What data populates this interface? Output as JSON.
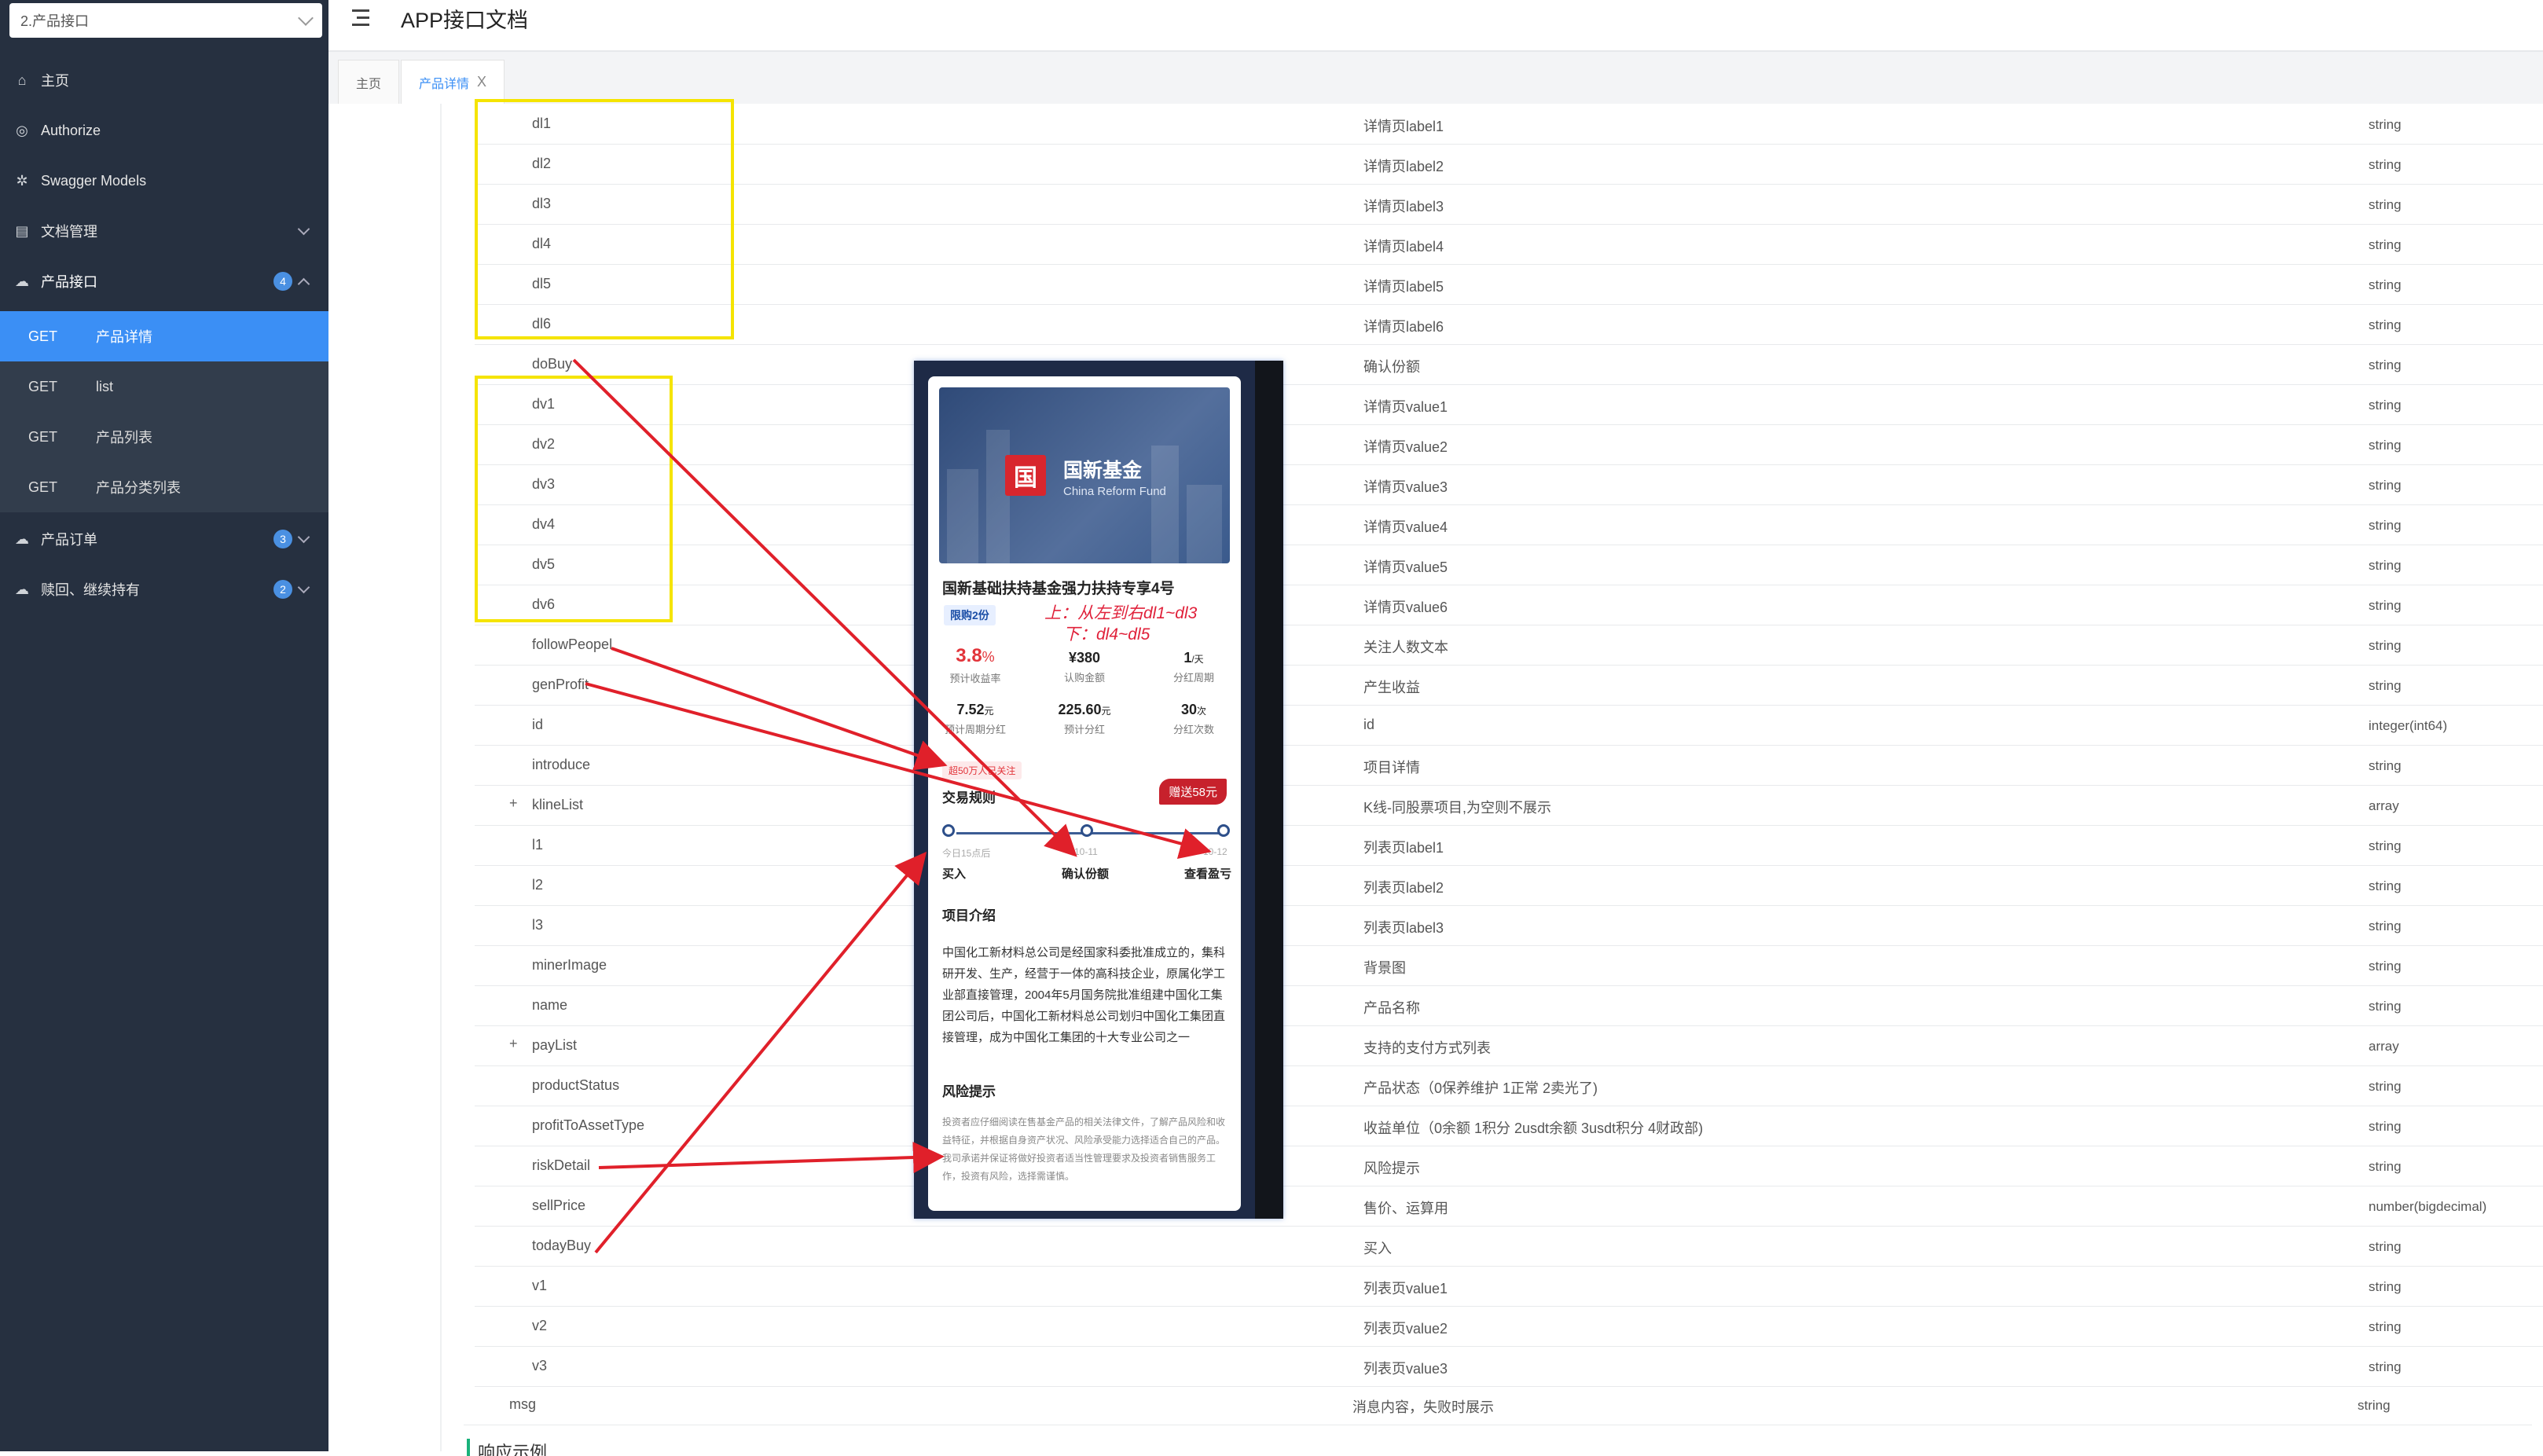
{
  "sidebar": {
    "group_select": "2.产品接口",
    "menu": [
      {
        "label": "主页"
      },
      {
        "label": "Authorize"
      },
      {
        "label": "Swagger Models"
      },
      {
        "label": "文档管理"
      },
      {
        "label": "产品接口",
        "badge": "4"
      }
    ],
    "sub_items": [
      {
        "method": "GET",
        "name": "产品详情"
      },
      {
        "method": "GET",
        "name": "list"
      },
      {
        "method": "GET",
        "name": "产品列表"
      },
      {
        "method": "GET",
        "name": "产品分类列表"
      }
    ],
    "menu_after": [
      {
        "label": "产品订单",
        "badge": "3"
      },
      {
        "label": "赎回、继续持有",
        "badge": "2"
      }
    ],
    "colors": {
      "bg": "#263040",
      "active": "#3b8ff5",
      "badge": "#4a90e2"
    }
  },
  "header": {
    "title": "APP接口文档",
    "menu_icon": "hamburger-icon"
  },
  "tabs": [
    {
      "label": "主页"
    },
    {
      "label": "产品详情",
      "close": "X"
    }
  ],
  "fields": [
    {
      "name": "dl1",
      "desc": "详情页label1",
      "type": "string"
    },
    {
      "name": "dl2",
      "desc": "详情页label2",
      "type": "string"
    },
    {
      "name": "dl3",
      "desc": "详情页label3",
      "type": "string"
    },
    {
      "name": "dl4",
      "desc": "详情页label4",
      "type": "string"
    },
    {
      "name": "dl5",
      "desc": "详情页label5",
      "type": "string"
    },
    {
      "name": "dl6",
      "desc": "详情页label6",
      "type": "string"
    },
    {
      "name": "doBuy",
      "desc": "确认份额",
      "type": "string"
    },
    {
      "name": "dv1",
      "desc": "详情页value1",
      "type": "string"
    },
    {
      "name": "dv2",
      "desc": "详情页value2",
      "type": "string"
    },
    {
      "name": "dv3",
      "desc": "详情页value3",
      "type": "string"
    },
    {
      "name": "dv4",
      "desc": "详情页value4",
      "type": "string"
    },
    {
      "name": "dv5",
      "desc": "详情页value5",
      "type": "string"
    },
    {
      "name": "dv6",
      "desc": "详情页value6",
      "type": "string"
    },
    {
      "name": "followPeopel",
      "desc": "关注人数文本",
      "type": "string"
    },
    {
      "name": "genProfit",
      "desc": "产生收益",
      "type": "string"
    },
    {
      "name": "id",
      "desc": "id",
      "type": "integer(int64)"
    },
    {
      "name": "introduce",
      "desc": "项目详情",
      "type": "string"
    },
    {
      "name": "klineList",
      "desc": "K线-同股票项目,为空则不展示",
      "type": "array",
      "expand": "+"
    },
    {
      "name": "l1",
      "desc": "列表页label1",
      "type": "string"
    },
    {
      "name": "l2",
      "desc": "列表页label2",
      "type": "string"
    },
    {
      "name": "l3",
      "desc": "列表页label3",
      "type": "string"
    },
    {
      "name": "minerImage",
      "desc": "背景图",
      "type": "string"
    },
    {
      "name": "name",
      "desc": "产品名称",
      "type": "string"
    },
    {
      "name": "payList",
      "desc": "支持的支付方式列表",
      "type": "array",
      "expand": "+"
    },
    {
      "name": "productStatus",
      "desc": "产品状态（0保养维护 1正常 2卖光了)",
      "type": "string"
    },
    {
      "name": "profitToAssetType",
      "desc": "收益单位（0余额 1积分 2usdt余额 3usdt积分 4财政部)",
      "type": "string"
    },
    {
      "name": "riskDetail",
      "desc": "风险提示",
      "type": "string"
    },
    {
      "name": "sellPrice",
      "desc": "售价、运算用",
      "type": "number(bigdecimal)"
    },
    {
      "name": "todayBuy",
      "desc": "买入",
      "type": "string"
    },
    {
      "name": "v1",
      "desc": "列表页value1",
      "type": "string"
    },
    {
      "name": "v2",
      "desc": "列表页value2",
      "type": "string"
    },
    {
      "name": "v3",
      "desc": "列表页value3",
      "type": "string"
    }
  ],
  "msg_row": {
    "name": "msg",
    "desc": "消息内容，失败时展示",
    "type": "string"
  },
  "response_heading": "响应示例",
  "phone": {
    "fund_name_cn": "国新基金",
    "fund_name_en": "China Reform Fund",
    "logo_char": "国",
    "product_title": "国新基础扶持基金强力扶持专享4号",
    "limit_tag": "限购2份",
    "annotation_line1": "上：从左到右dl1~dl3",
    "annotation_line2": "下：dl4~dl5",
    "stats_top": [
      {
        "value": "3.8",
        "unit": "%",
        "label": "预计收益率"
      },
      {
        "value": "¥380",
        "unit": "",
        "label": "认购金额"
      },
      {
        "value": "1",
        "unit": "/天",
        "label": "分红周期"
      }
    ],
    "stats_bottom": [
      {
        "value": "7.52",
        "unit": "元",
        "label": "预计周期分红"
      },
      {
        "value": "225.60",
        "unit": "元",
        "label": "预计分红"
      },
      {
        "value": "30",
        "unit": "次",
        "label": "分红次数"
      }
    ],
    "follow_tag": "超50万人已关注",
    "rules_heading": "交易规则",
    "gift_badge": "赠送58元",
    "timeline": [
      {
        "date": "今日15点后",
        "label": "买入"
      },
      {
        "date": "10-11",
        "label": "确认份额"
      },
      {
        "date": "10-12",
        "label": "查看盈亏"
      }
    ],
    "intro_heading": "项目介绍",
    "intro_text": "中国化工新材料总公司是经国家科委批准成立的，集科研开发、生产，经营于一体的高科技企业，原属化学工业部直接管理，2004年5月国务院批准组建中国化工集团公司后，中国化工新材料总公司划归中国化工集团直接管理，成为中国化工集团的十大专业公司之一",
    "risk_heading": "风险提示",
    "risk_text": "投资者应仔细阅读在售基金产品的相关法律文件，了解产品风险和收益特征，并根据自身资产状况、风险承受能力选择适合自己的产品。我司承诺并保证将做好投资者适当性管理要求及投资者销售服务工作，投资有风险，选择需谨慎。"
  },
  "colors": {
    "highlight_box": "#f5e400",
    "arrow": "#e0202a"
  }
}
